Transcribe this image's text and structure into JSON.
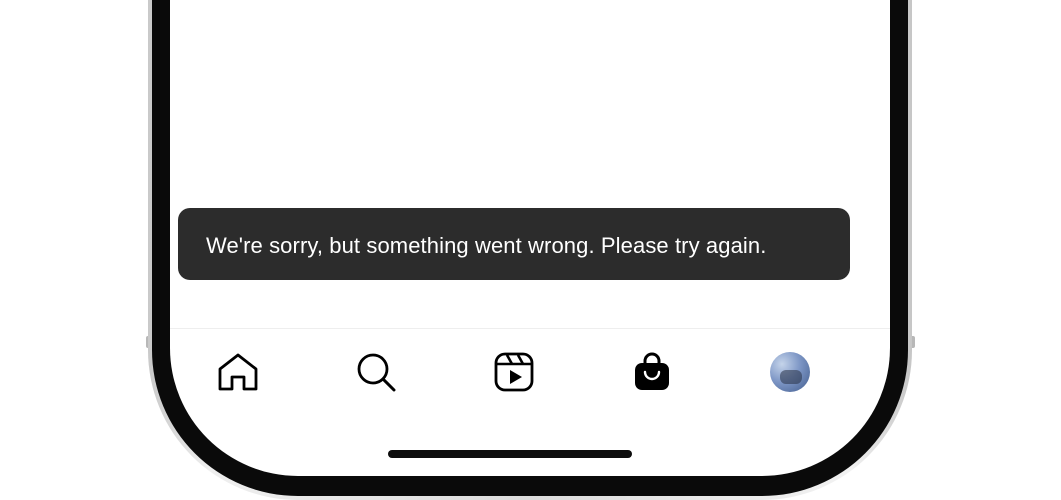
{
  "toast": {
    "message": "We're sorry, but something went wrong. Please try again."
  },
  "tab_bar": {
    "items": [
      {
        "icon": "home-icon",
        "active": false
      },
      {
        "icon": "search-icon",
        "active": false
      },
      {
        "icon": "reels-icon",
        "active": false
      },
      {
        "icon": "shop-bag-icon",
        "active": true
      },
      {
        "icon": "profile-avatar",
        "active": false
      }
    ]
  },
  "colors": {
    "toast_background": "#2c2c2c",
    "toast_text": "#ffffff",
    "icon": "#000000",
    "screen_background": "#ffffff",
    "bezel": "#0a0a0a"
  }
}
